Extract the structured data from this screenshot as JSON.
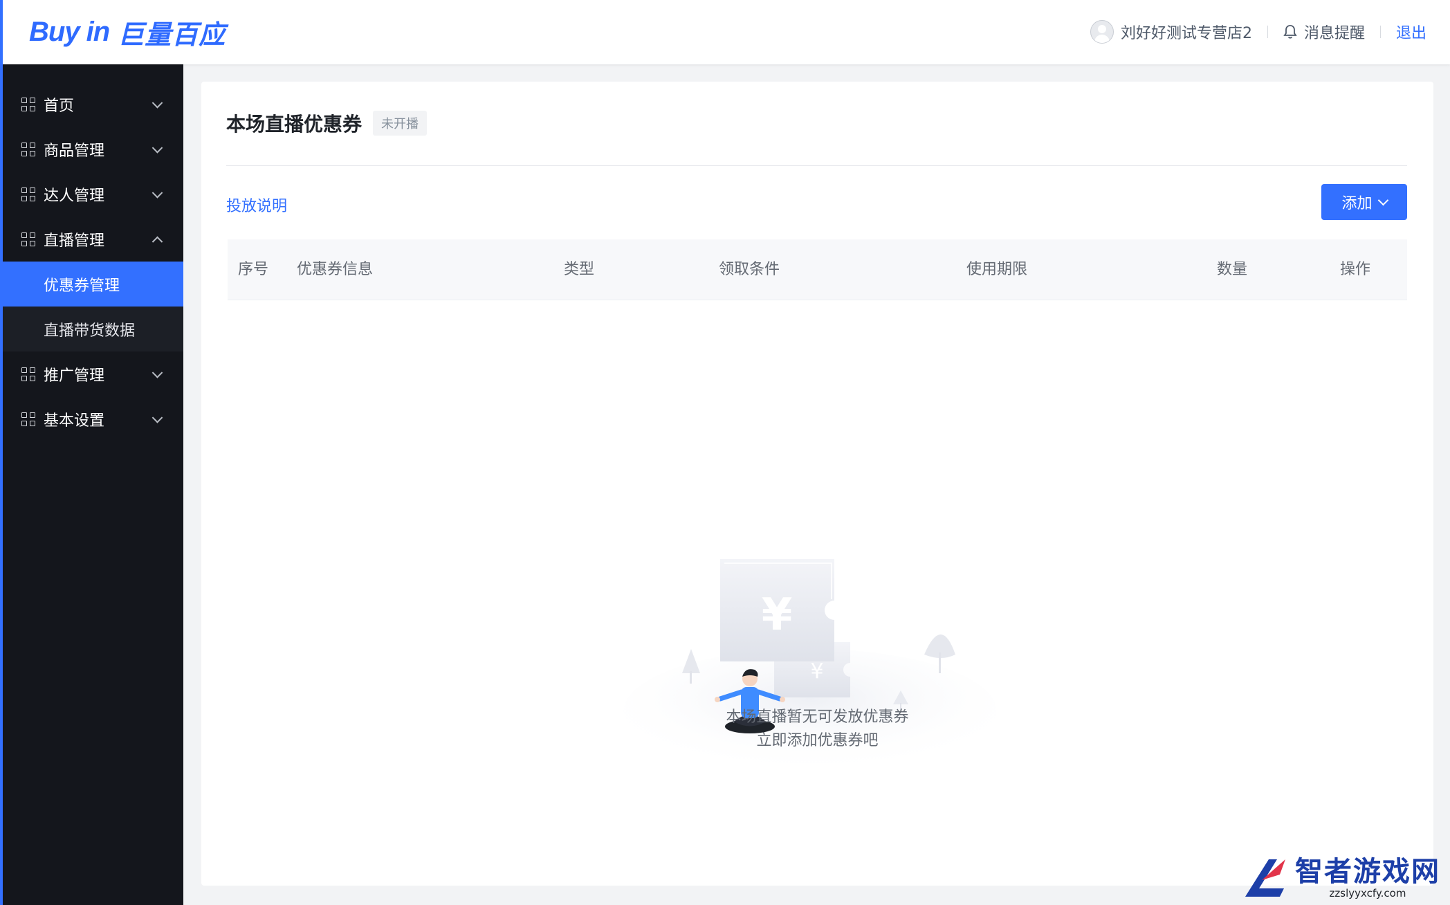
{
  "header": {
    "logo_en": "Buy in",
    "logo_cn": "巨量百应",
    "shop_name": "刘好好测试专营店2",
    "notifications_label": "消息提醒",
    "logout_label": "退出"
  },
  "sidebar": {
    "items": [
      {
        "label": "首页",
        "expanded": false
      },
      {
        "label": "商品管理",
        "expanded": false
      },
      {
        "label": "达人管理",
        "expanded": false
      },
      {
        "label": "直播管理",
        "expanded": true,
        "children": [
          {
            "label": "优惠券管理",
            "active": true
          },
          {
            "label": "直播带货数据",
            "active": false
          }
        ]
      },
      {
        "label": "推广管理",
        "expanded": false
      },
      {
        "label": "基本设置",
        "expanded": false
      }
    ]
  },
  "main": {
    "title": "本场直播优惠券",
    "status_tag": "未开播",
    "instructions_link": "投放说明",
    "add_button": "添加",
    "table": {
      "columns": [
        "序号",
        "优惠券信息",
        "类型",
        "领取条件",
        "使用期限",
        "数量",
        "操作"
      ],
      "rows": []
    },
    "empty": {
      "line1": "本场直播暂无可发放优惠券",
      "line2": "立即添加优惠券吧"
    }
  },
  "watermark": {
    "title": "智者游戏网",
    "url": "zzslyyxcfy.com"
  },
  "colors": {
    "accent": "#3370ff",
    "sidebar_bg": "#14161c",
    "page_bg": "#f2f3f5"
  }
}
